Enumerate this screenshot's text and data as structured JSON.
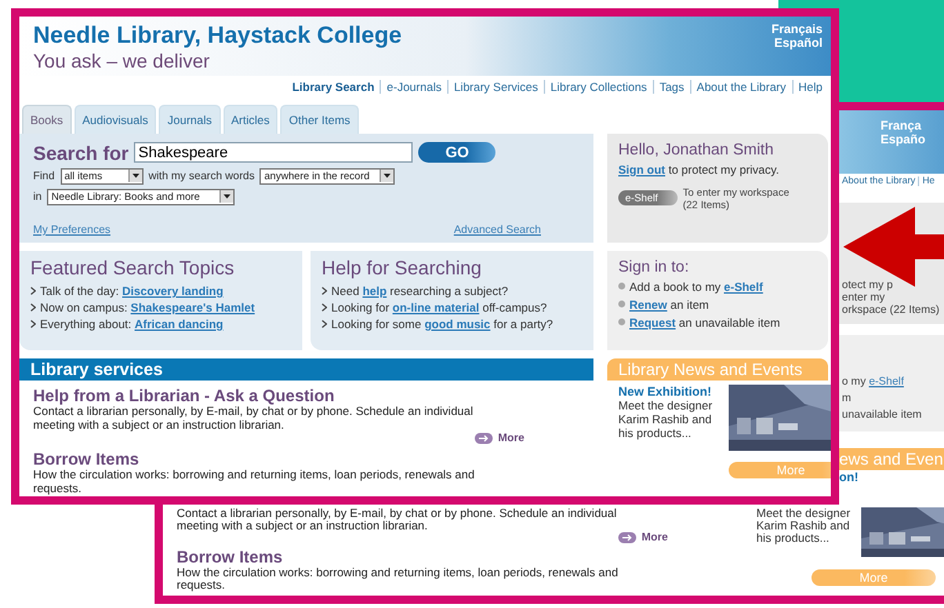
{
  "header": {
    "title": "Needle Library, Haystack College",
    "tagline": "You ask – we deliver",
    "languages": [
      "Français",
      "Español"
    ]
  },
  "nav": [
    {
      "label": "Library Search",
      "selected": true
    },
    {
      "label": "e-Journals",
      "selected": false
    },
    {
      "label": "Library Services",
      "selected": false
    },
    {
      "label": "Library Collections",
      "selected": false
    },
    {
      "label": "Tags",
      "selected": false
    },
    {
      "label": "About the Library",
      "selected": false
    },
    {
      "label": "Help",
      "selected": false
    }
  ],
  "tabs": [
    {
      "label": "Books",
      "selected": true
    },
    {
      "label": "Audiovisuals",
      "selected": false
    },
    {
      "label": "Journals",
      "selected": false
    },
    {
      "label": "Articles",
      "selected": false
    },
    {
      "label": "Other Items",
      "selected": false
    }
  ],
  "search": {
    "label": "Search for",
    "value": "Shakespeare",
    "button": "GO",
    "find_label": "Find",
    "find_value": "all items",
    "words_label": "with my search words",
    "words_value": "anywhere in the record",
    "in_label": "in",
    "in_value": "Needle Library: Books and more",
    "preferences_link": "My Preferences",
    "advanced_link": "Advanced Search"
  },
  "featured": {
    "title": "Featured Search Topics",
    "items": [
      {
        "before": "Talk of the day: ",
        "link": "Discovery landing"
      },
      {
        "before": "Now on campus: ",
        "link": "Shakespeare's Hamlet"
      },
      {
        "before": "Everything about: ",
        "link": "African dancing"
      }
    ]
  },
  "help": {
    "title": "Help for Searching",
    "items": [
      {
        "before": "Need ",
        "link": "help",
        "after": " researching a subject?"
      },
      {
        "before": "Looking for ",
        "link": "on-line material",
        "after": " off-campus?"
      },
      {
        "before": "Looking for some ",
        "link": "good music",
        "after": " for a party?"
      }
    ]
  },
  "user_panel": {
    "greeting": "Hello, Jonathan Smith",
    "sign_out_link": "Sign out",
    "sign_out_text": " to protect my privacy.",
    "eshelf_button": "e-Shelf",
    "eshelf_text": "To enter my workspace (22 Items)"
  },
  "sign_in": {
    "title": "Sign in to:",
    "items": [
      {
        "before": "Add a book to my ",
        "link": "e-Shelf"
      },
      {
        "link": "Renew",
        "after": " an item"
      },
      {
        "link": "Request",
        "after": " an unavailable item"
      }
    ]
  },
  "services": {
    "title": "Library services",
    "more": "More",
    "items": [
      {
        "title": "Help from a Librarian - Ask a Question",
        "description": "Contact a librarian personally, by E-mail, by chat or by phone. Schedule an individual meeting with a subject or an instruction librarian."
      },
      {
        "title": "Borrow Items",
        "description": "How the circulation works: borrowing and returning items, loan periods, renewals and requests."
      }
    ]
  },
  "news": {
    "title": "Library News and Events",
    "headline": "New Exhibition!",
    "text": "Meet the designer Karim Rashib and his products...",
    "more": "More"
  },
  "background_copy": {
    "languages": [
      "França",
      "Españo"
    ],
    "nav": [
      "About the Library",
      "He"
    ],
    "user_lines": [
      "otect my p",
      "enter my",
      "orkspace (22 Items)"
    ],
    "sign_in_lines": [
      {
        "before": "o my ",
        "link": "e-Shelf"
      },
      {
        "before": "m"
      },
      {
        "before": "unavailable item"
      }
    ],
    "news_title": "ews and Even",
    "news_headline": "on!",
    "service_description": "Contact a librarian personally, by E-mail, by chat or by phone. Schedule an individual meeting with a subject or an instruction librarian.",
    "more": "More",
    "item_title": "Borrow Items",
    "item_description": "How the circulation works: borrowing and returning items, loan periods, renewals and requests.",
    "news_text": "Meet the designer Karim Rashib and his products...",
    "news_more": "More"
  }
}
